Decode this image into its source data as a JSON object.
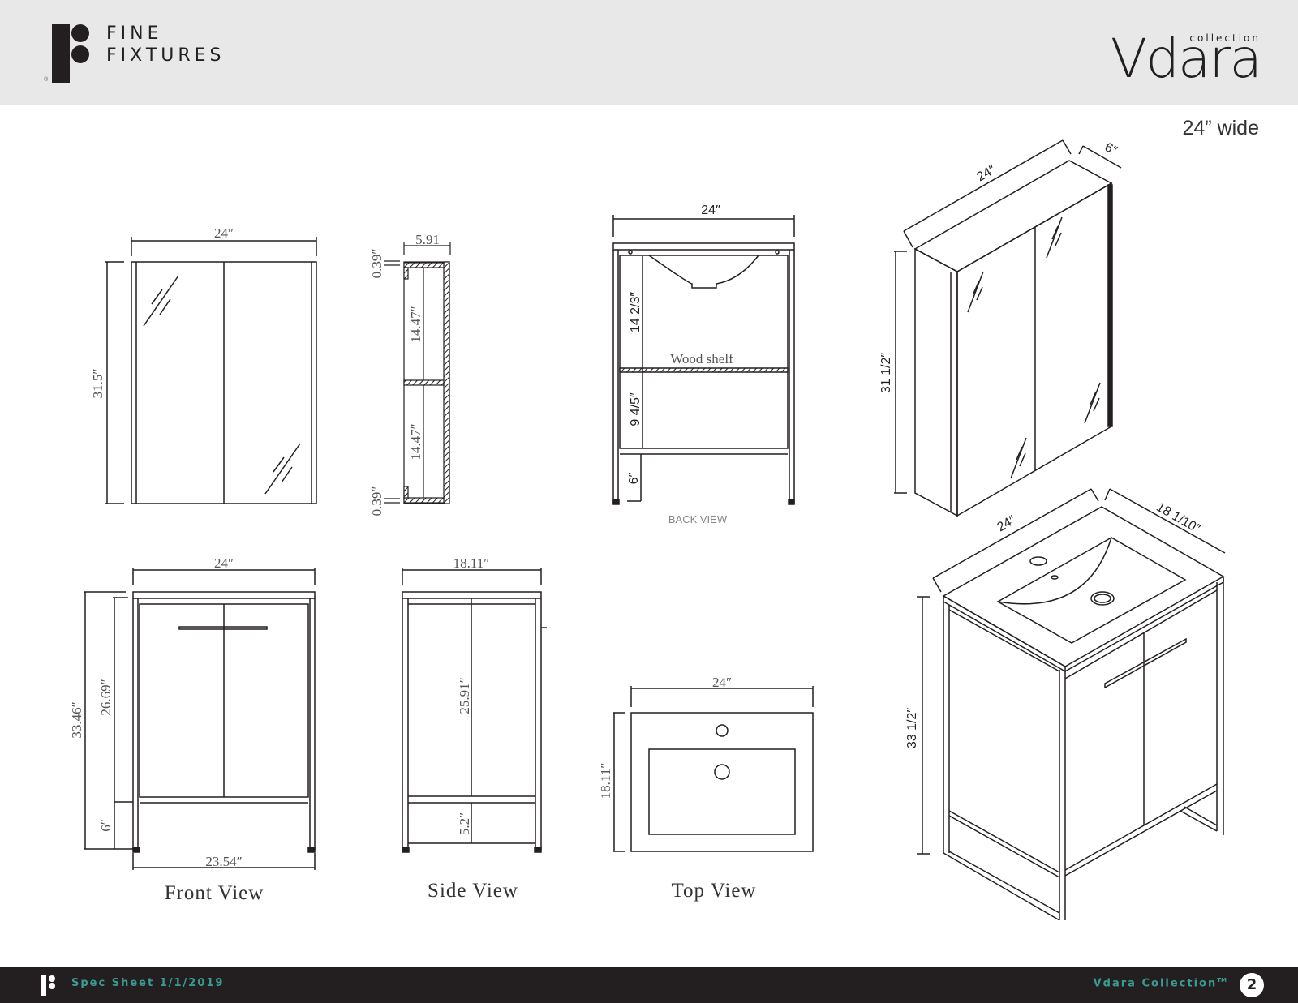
{
  "header": {
    "brand_line1": "FINE",
    "brand_line2": "FIXTURES",
    "registered": "®",
    "collection_logo_main": "Vdara",
    "collection_logo_sub": "collection",
    "width_label": "24” wide"
  },
  "views": {
    "mirror_front": {
      "width": "24″",
      "height": "31.5″"
    },
    "mirror_section": {
      "depth": "5.91",
      "top_gap": "0.39″",
      "bottom_gap": "0.39″",
      "upper_shelf": "14.47″",
      "lower_shelf": "14.47″"
    },
    "back_view": {
      "label": "BACK VIEW",
      "width": "24″",
      "upper": "14 2/3″",
      "lower": "9 4/5″",
      "legs": "6″",
      "shelf_label": "Wood shelf"
    },
    "mirror_iso": {
      "width": "24″",
      "depth": "6″",
      "height": "31 1/2″"
    },
    "front_view": {
      "label": "Front View",
      "width": "24″",
      "overall_height": "33.46″",
      "cabinet_height": "26.69″",
      "leg_height": "6″",
      "base_width": "23.54″"
    },
    "side_view": {
      "label": "Side View",
      "depth": "18.11″",
      "cabinet_height": "25.91″",
      "leg_height": "5.2″"
    },
    "top_view": {
      "label": "Top View",
      "width": "24″",
      "depth": "18.11″"
    },
    "vanity_iso": {
      "width": "24″",
      "depth": "18 1/10″",
      "height": "33 1/2″"
    }
  },
  "footer": {
    "left_text": "Spec Sheet 1/1/2019",
    "right_text": "Vdara Collection",
    "trademark": "TM",
    "page_number": "2"
  },
  "colors": {
    "header_bg": "#e8e8e8",
    "footer_bg": "#231f20",
    "footer_accent": "#3a9b92",
    "line": "#231f20"
  }
}
